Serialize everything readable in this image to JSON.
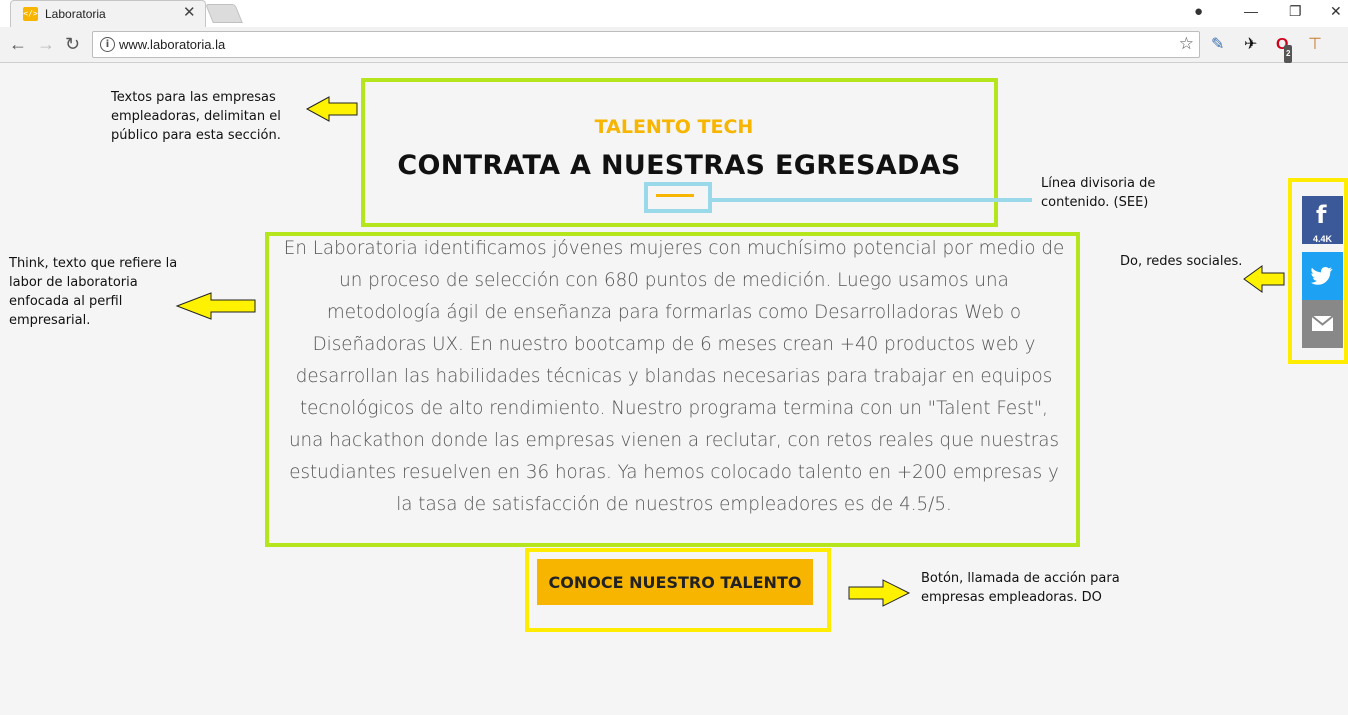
{
  "browser": {
    "tab_title": "Laboratoria",
    "favicon_text": "</>",
    "url": "www.laboratoria.la",
    "extension_badge": "2"
  },
  "section": {
    "kicker": "TALENTO TECH",
    "heading": "CONTRATA A NUESTRAS EGRESADAS",
    "body_lines": [
      "En Laboratoria identificamos jóvenes mujeres con muchísimo potencial por medio de",
      "un proceso de selección con 680 puntos de medición. Luego usamos una",
      "metodología ágil de enseñanza para formarlas como Desarrolladoras Web o",
      "Diseñadoras UX. En nuestro bootcamp de 6 meses crean +40 productos web y",
      "desarrollan las habilidades técnicas y blandas necesarias para trabajar en equipos",
      "tecnológicos de alto rendimiento. Nuestro programa termina con un \"Talent Fest\",",
      "una hackathon donde las empresas vienen a reclutar, con retos reales que nuestras",
      "estudiantes resuelven en 36 horas. Ya hemos colocado talento en +200 empresas y",
      "la tasa de satisfacción de nuestros empleadores es de 4.5/5."
    ],
    "cta_label": "CONOCE NUESTRO TALENTO"
  },
  "social": {
    "facebook_count": "4.4K"
  },
  "annotations": {
    "header_note": [
      "Textos para las empresas",
      "empleadoras, delimitan el",
      "público para esta sección."
    ],
    "divider_note": [
      "Línea divisoria de",
      "contenido. (SEE)"
    ],
    "think_note": [
      "Think, texto que refiere la",
      "labor de laboratoria",
      "enfocada al perfil",
      "empresarial."
    ],
    "social_note": [
      "Do, redes sociales."
    ],
    "button_note": [
      "Botón, llamada de acción para",
      "empresas empleadoras. DO"
    ]
  },
  "colors": {
    "brand_yellow": "#f7b500",
    "annotation_green": "#b5e51d",
    "annotation_yellow": "#ffec00",
    "annotation_blue": "#99d9ea",
    "facebook": "#3b5998",
    "twitter": "#1da1f2",
    "email": "#888888"
  }
}
